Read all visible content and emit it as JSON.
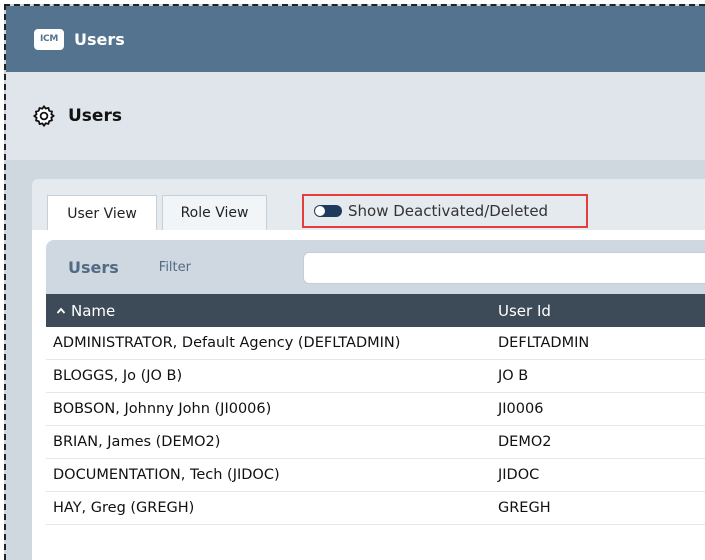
{
  "app": {
    "badge": "ICM",
    "title": "Users"
  },
  "page": {
    "title": "Users"
  },
  "tabs": [
    {
      "label": "User View",
      "active": true
    },
    {
      "label": "Role View",
      "active": false
    }
  ],
  "toggle": {
    "label": "Show Deactivated/Deleted",
    "on": false
  },
  "list": {
    "heading": "Users",
    "filter_label": "Filter",
    "filter_value": "",
    "columns": [
      "Name",
      "User Id"
    ],
    "sort": {
      "column": "Name",
      "direction": "ascending"
    },
    "rows": [
      {
        "name": "ADMINISTRATOR, Default Agency (DEFLTADMIN)",
        "user_id": "DEFLTADMIN"
      },
      {
        "name": "BLOGGS, Jo (JO B)",
        "user_id": "JO B"
      },
      {
        "name": "BOBSON, Johnny John (JI0006)",
        "user_id": "JI0006"
      },
      {
        "name": "BRIAN, James (DEMO2)",
        "user_id": "DEMO2"
      },
      {
        "name": "DOCUMENTATION, Tech (JIDOC)",
        "user_id": "JIDOC"
      },
      {
        "name": "HAY, Greg (GREGH)",
        "user_id": "GREGH"
      }
    ]
  },
  "colors": {
    "titlebar": "#54738e",
    "table_header": "#3d4a57",
    "highlight_border": "#e53e3e",
    "accent_text": "#516b84"
  }
}
